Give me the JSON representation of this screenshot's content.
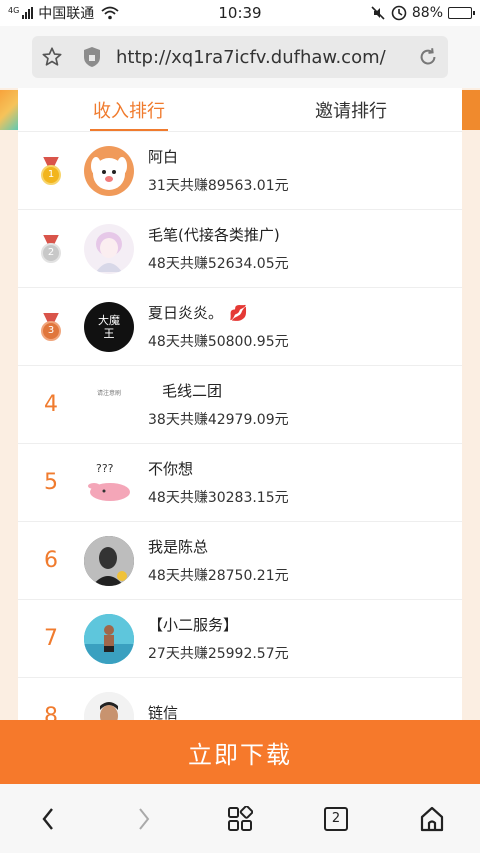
{
  "status_bar": {
    "network": "4G",
    "carrier": "中国联通",
    "time": "10:39",
    "battery": "88%",
    "battery_level": 0.88
  },
  "browser": {
    "url": "http://xq1ra7icfv.dufhaw.com/"
  },
  "tabs": [
    {
      "label": "收入排行",
      "active": true
    },
    {
      "label": "邀请排行",
      "active": false
    }
  ],
  "ranking": [
    {
      "rank": "1",
      "medal": "gold",
      "name": "阿白",
      "earn": "31天共赚89563.01元"
    },
    {
      "rank": "2",
      "medal": "silver",
      "name": "毛笔(代接各类推广)",
      "earn": "48天共赚52634.05元"
    },
    {
      "rank": "3",
      "medal": "bronze",
      "name": "夏日炎炎。",
      "name_emoji": "💋",
      "avatar_text": "大魔王",
      "earn": "48天共赚50800.95元"
    },
    {
      "rank": "4",
      "name": "毛线二团",
      "avatar_text": "请注意刷",
      "earn": "38天共赚42979.09元"
    },
    {
      "rank": "5",
      "name": "不你想",
      "avatar_text": "???",
      "earn": "48天共赚30283.15元"
    },
    {
      "rank": "6",
      "name": "我是陈总",
      "earn": "48天共赚28750.21元"
    },
    {
      "rank": "7",
      "name": "【小二服务】",
      "earn": "27天共赚25992.57元"
    },
    {
      "rank": "8",
      "name": "链信",
      "earn": ""
    }
  ],
  "download_button": "立即下载",
  "bottom_nav": {
    "tab_count": "2"
  },
  "colors": {
    "accent": "#f6792b",
    "rank_text": "#f07b2e",
    "page_bg": "#fbeee2"
  }
}
